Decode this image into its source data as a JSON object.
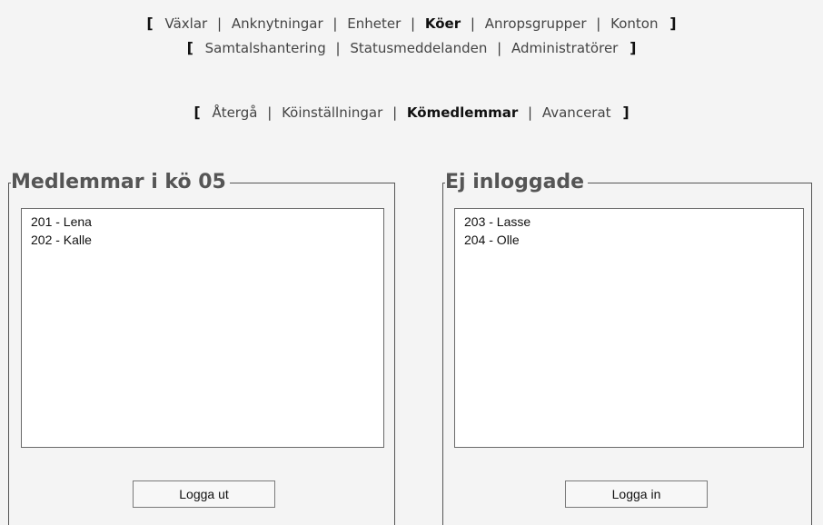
{
  "nav_main": {
    "row1": [
      "Växlar",
      "Anknytningar",
      "Enheter",
      "Köer",
      "Anropsgrupper",
      "Konton"
    ],
    "row1_active": 3,
    "row2": [
      "Samtalshantering",
      "Statusmeddelanden",
      "Administratörer"
    ]
  },
  "nav_sub": {
    "items": [
      "Återgå",
      "Köinställningar",
      "Kömedlemmar",
      "Avancerat"
    ],
    "active": 2
  },
  "brackets": {
    "open": "[",
    "close": "]",
    "sep": "|"
  },
  "left_panel": {
    "title": "Medlemmar i kö 05",
    "items": [
      "201 - Lena",
      "202 - Kalle"
    ],
    "button_label": "Logga ut"
  },
  "right_panel": {
    "title": "Ej inloggade",
    "items": [
      "203 - Lasse",
      "204 - Olle"
    ],
    "button_label": "Logga in"
  }
}
